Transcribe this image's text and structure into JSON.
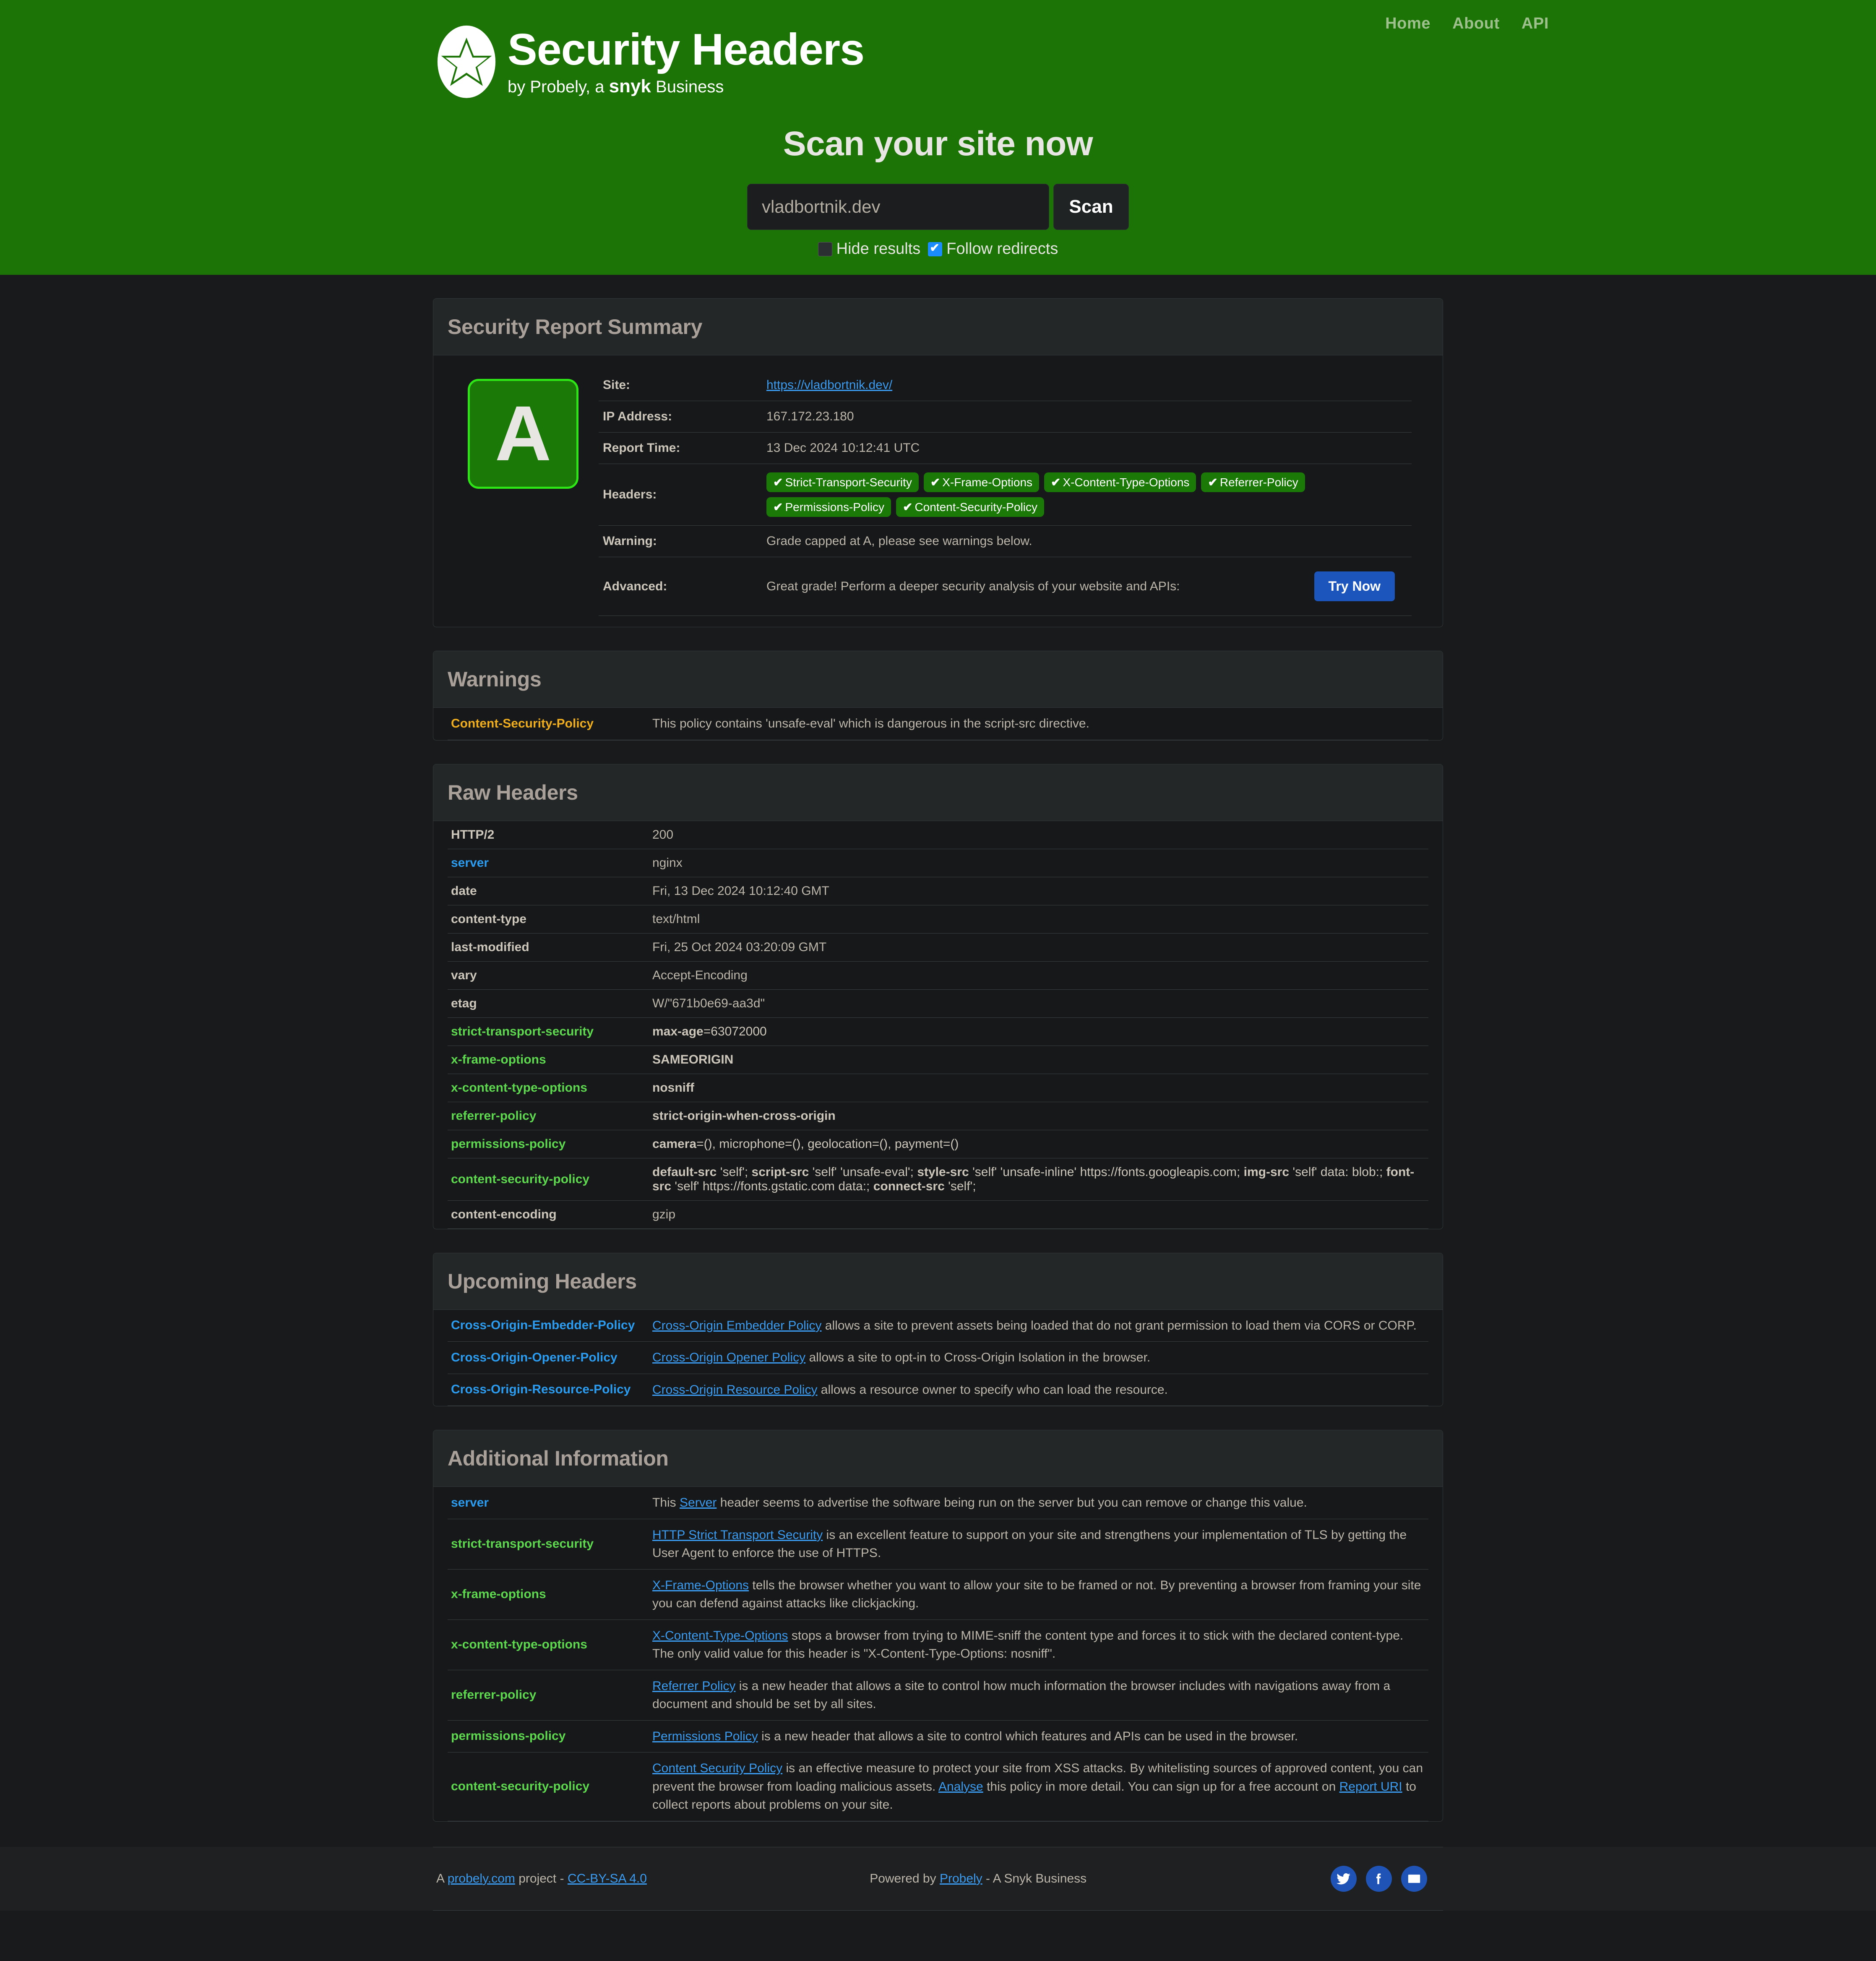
{
  "nav": {
    "items": [
      "Home",
      "About",
      "API"
    ]
  },
  "logo": {
    "title": "Security Headers",
    "subtitle_pre": "by Probely, a ",
    "subtitle_brand": "snyk",
    "subtitle_post": " Business"
  },
  "hero": {
    "title": "Scan your site now",
    "input_value": "vladbortnik.dev",
    "input_placeholder": "vladbortnik.dev",
    "scan_label": "Scan",
    "hide_results_label": "Hide results",
    "follow_redirects_label": "Follow redirects",
    "hide_results_checked": false,
    "follow_redirects_checked": true,
    "bg_color": "#1c7406"
  },
  "summary": {
    "panel_title": "Security Report Summary",
    "grade": "A",
    "grade_bg": "#1b7a07",
    "grade_border": "#2ee616",
    "labels": {
      "site": "Site:",
      "ip": "IP Address:",
      "time": "Report Time:",
      "headers": "Headers:",
      "warning": "Warning:",
      "advanced": "Advanced:"
    },
    "site_url": "https://vladbortnik.dev/",
    "ip_address": "167.172.23.180",
    "report_time": "13 Dec 2024 10:12:41 UTC",
    "header_pills": [
      "Strict-Transport-Security",
      "X-Frame-Options",
      "X-Content-Type-Options",
      "Referrer-Policy",
      "Permissions-Policy",
      "Content-Security-Policy"
    ],
    "warning_text": "Grade capped at A, please see warnings below.",
    "advanced_text": "Great grade! Perform a deeper security analysis of your website and APIs:",
    "try_now_label": "Try Now",
    "try_now_color": "#1c56bd"
  },
  "warnings": {
    "panel_title": "Warnings",
    "rows": [
      {
        "name": "Content-Security-Policy",
        "text": "This policy contains 'unsafe-eval' which is dangerous in the script-src directive."
      }
    ]
  },
  "raw_headers": {
    "panel_title": "Raw Headers",
    "rows": [
      {
        "name": "HTTP/2",
        "style": "plain",
        "value": "200",
        "bold": false
      },
      {
        "name": "server",
        "style": "blue",
        "value": "nginx",
        "bold": false
      },
      {
        "name": "date",
        "style": "plain",
        "value": "Fri, 13 Dec 2024 10:12:40 GMT",
        "bold": false
      },
      {
        "name": "content-type",
        "style": "plain",
        "value": "text/html",
        "bold": false
      },
      {
        "name": "last-modified",
        "style": "plain",
        "value": "Fri, 25 Oct 2024 03:20:09 GMT",
        "bold": false
      },
      {
        "name": "vary",
        "style": "plain",
        "value": "Accept-Encoding",
        "bold": false
      },
      {
        "name": "etag",
        "style": "plain",
        "value": "W/\"671b0e69-aa3d\"",
        "bold": false
      },
      {
        "name": "strict-transport-security",
        "style": "green",
        "value": "max-age=63072000",
        "bold": true
      },
      {
        "name": "x-frame-options",
        "style": "green",
        "value": "SAMEORIGIN",
        "bold": true
      },
      {
        "name": "x-content-type-options",
        "style": "green",
        "value": "nosniff",
        "bold": true
      },
      {
        "name": "referrer-policy",
        "style": "green",
        "value": "strict-origin-when-cross-origin",
        "bold": true
      },
      {
        "name": "permissions-policy",
        "style": "green",
        "value": "camera=(), microphone=(), geolocation=(), payment=()",
        "bold": true
      },
      {
        "name": "content-security-policy",
        "style": "green",
        "value": "default-src 'self'; script-src 'self' 'unsafe-eval'; style-src 'self' 'unsafe-inline' https://fonts.googleapis.com; img-src 'self' data: blob:; font-src 'self' https://fonts.gstatic.com data:; connect-src 'self';",
        "bold": true
      },
      {
        "name": "content-encoding",
        "style": "plain",
        "value": "gzip",
        "bold": false
      }
    ]
  },
  "upcoming_headers": {
    "panel_title": "Upcoming Headers",
    "rows": [
      {
        "name": "Cross-Origin-Embedder-Policy",
        "link": "Cross-Origin Embedder Policy",
        "text": " allows a site to prevent assets being loaded that do not grant permission to load them via CORS or CORP."
      },
      {
        "name": "Cross-Origin-Opener-Policy",
        "link": "Cross-Origin Opener Policy",
        "text": " allows a site to opt-in to Cross-Origin Isolation in the browser."
      },
      {
        "name": "Cross-Origin-Resource-Policy",
        "link": "Cross-Origin Resource Policy",
        "text": " allows a resource owner to specify who can load the resource."
      }
    ]
  },
  "additional_information": {
    "panel_title": "Additional Information",
    "rows": [
      {
        "name": "server",
        "style": "blue",
        "pre": "This ",
        "link": "Server",
        "text": " header seems to advertise the software being run on the server but you can remove or change this value."
      },
      {
        "name": "strict-transport-security",
        "style": "green",
        "pre": "",
        "link": "HTTP Strict Transport Security",
        "text": " is an excellent feature to support on your site and strengthens your implementation of TLS by getting the User Agent to enforce the use of HTTPS."
      },
      {
        "name": "x-frame-options",
        "style": "green",
        "pre": "",
        "link": "X-Frame-Options",
        "text": " tells the browser whether you want to allow your site to be framed or not. By preventing a browser from framing your site you can defend against attacks like clickjacking."
      },
      {
        "name": "x-content-type-options",
        "style": "green",
        "pre": "",
        "link": "X-Content-Type-Options",
        "text": " stops a browser from trying to MIME-sniff the content type and forces it to stick with the declared content-type. The only valid value for this header is \"X-Content-Type-Options: nosniff\"."
      },
      {
        "name": "referrer-policy",
        "style": "green",
        "pre": "",
        "link": "Referrer Policy",
        "text": " is a new header that allows a site to control how much information the browser includes with navigations away from a document and should be set by all sites."
      },
      {
        "name": "permissions-policy",
        "style": "green",
        "pre": "",
        "link": "Permissions Policy",
        "text": " is a new header that allows a site to control which features and APIs can be used in the browser."
      },
      {
        "name": "content-security-policy",
        "style": "green",
        "pre": "",
        "link": "Content Security Policy",
        "text": " is an effective measure to protect your site from XSS attacks. By whitelisting sources of approved content, you can prevent the browser from loading malicious assets. ",
        "link2": "Analyse",
        "text2": " this policy in more detail. You can sign up for a free account on ",
        "link3": "Report URI",
        "text3": " to collect reports about problems on your site."
      }
    ]
  },
  "footer": {
    "left_pre": "A ",
    "left_link1": "probely.com",
    "left_mid": " project - ",
    "left_link2": "CC-BY-SA 4.0",
    "center_pre": "Powered by ",
    "center_link": "Probely",
    "center_post": " - A Snyk Business",
    "social": [
      "twitter-icon",
      "facebook-icon",
      "mail-icon"
    ]
  }
}
